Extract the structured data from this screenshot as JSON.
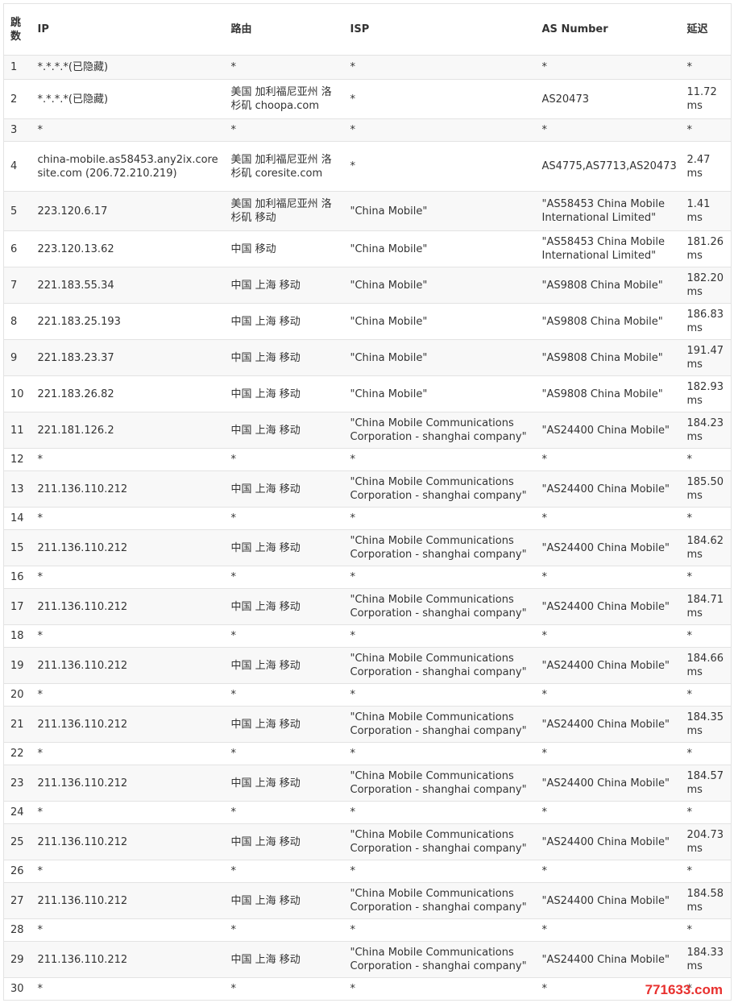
{
  "headers": [
    "跳数",
    "IP",
    "路由",
    "ISP",
    "AS Number",
    "延迟"
  ],
  "rows": [
    {
      "hop": "1",
      "ip": "*.*.*.*(已隐藏)",
      "route": "*",
      "isp": "*",
      "asn": "*",
      "delay": "*",
      "h": 30
    },
    {
      "hop": "2",
      "ip": "*.*.*.*(已隐藏)",
      "route": "美国 加利福尼亚州 洛杉矶 choopa.com",
      "isp": "*",
      "asn": "AS20473",
      "delay": "11.72 ms",
      "h": 49
    },
    {
      "hop": "3",
      "ip": "*",
      "route": "*",
      "isp": "*",
      "asn": "*",
      "delay": "*",
      "h": 28
    },
    {
      "hop": "4",
      "ip": "china-mobile.as58453.any2ix.coresite.com (206.72.210.219)",
      "route": "美国 加利福尼亚州 洛杉矶 coresite.com",
      "isp": "*",
      "asn": "AS4775,AS7713,AS20473",
      "delay": "2.47 ms",
      "h": 62
    },
    {
      "hop": "5",
      "ip": "223.120.6.17",
      "route": "美国 加利福尼亚州 洛杉矶 移动",
      "isp": "\"China Mobile\"",
      "asn": "\"AS58453 China Mobile International Limited\"",
      "delay": "1.41 ms",
      "h": 49
    },
    {
      "hop": "6",
      "ip": "223.120.13.62",
      "route": "中国 移动",
      "isp": "\"China Mobile\"",
      "asn": "\"AS58453 China Mobile International Limited\"",
      "delay": "181.26 ms",
      "h": 45
    },
    {
      "hop": "7",
      "ip": "221.183.55.34",
      "route": "中国 上海 移动",
      "isp": "\"China Mobile\"",
      "asn": "\"AS9808 China Mobile\"",
      "delay": "182.20 ms",
      "h": 45
    },
    {
      "hop": "8",
      "ip": "221.183.25.193",
      "route": "中国 上海 移动",
      "isp": "\"China Mobile\"",
      "asn": "\"AS9808 China Mobile\"",
      "delay": "186.83 ms",
      "h": 45
    },
    {
      "hop": "9",
      "ip": "221.183.23.37",
      "route": "中国 上海 移动",
      "isp": "\"China Mobile\"",
      "asn": "\"AS9808 China Mobile\"",
      "delay": "191.47 ms",
      "h": 45
    },
    {
      "hop": "10",
      "ip": "221.183.26.82",
      "route": "中国 上海 移动",
      "isp": "\"China Mobile\"",
      "asn": "\"AS9808 China Mobile\"",
      "delay": "182.93 ms",
      "h": 45
    },
    {
      "hop": "11",
      "ip": "221.181.126.2",
      "route": "中国 上海 移动",
      "isp": "\"China Mobile Communications Corporation - shanghai company\"",
      "asn": "\"AS24400 China Mobile\"",
      "delay": "184.23 ms",
      "h": 45
    },
    {
      "hop": "12",
      "ip": "*",
      "route": "*",
      "isp": "*",
      "asn": "*",
      "delay": "*",
      "h": 28
    },
    {
      "hop": "13",
      "ip": "211.136.110.212",
      "route": "中国 上海 移动",
      "isp": "\"China Mobile Communications Corporation - shanghai company\"",
      "asn": "\"AS24400 China Mobile\"",
      "delay": "185.50 ms",
      "h": 45
    },
    {
      "hop": "14",
      "ip": "*",
      "route": "*",
      "isp": "*",
      "asn": "*",
      "delay": "*",
      "h": 28
    },
    {
      "hop": "15",
      "ip": "211.136.110.212",
      "route": "中国 上海 移动",
      "isp": "\"China Mobile Communications Corporation - shanghai company\"",
      "asn": "\"AS24400 China Mobile\"",
      "delay": "184.62 ms",
      "h": 45
    },
    {
      "hop": "16",
      "ip": "*",
      "route": "*",
      "isp": "*",
      "asn": "*",
      "delay": "*",
      "h": 28
    },
    {
      "hop": "17",
      "ip": "211.136.110.212",
      "route": "中国 上海 移动",
      "isp": "\"China Mobile Communications Corporation - shanghai company\"",
      "asn": "\"AS24400 China Mobile\"",
      "delay": "184.71 ms",
      "h": 45
    },
    {
      "hop": "18",
      "ip": "*",
      "route": "*",
      "isp": "*",
      "asn": "*",
      "delay": "*",
      "h": 28
    },
    {
      "hop": "19",
      "ip": "211.136.110.212",
      "route": "中国 上海 移动",
      "isp": "\"China Mobile Communications Corporation - shanghai company\"",
      "asn": "\"AS24400 China Mobile\"",
      "delay": "184.66 ms",
      "h": 45
    },
    {
      "hop": "20",
      "ip": "*",
      "route": "*",
      "isp": "*",
      "asn": "*",
      "delay": "*",
      "h": 28
    },
    {
      "hop": "21",
      "ip": "211.136.110.212",
      "route": "中国 上海 移动",
      "isp": "\"China Mobile Communications Corporation - shanghai company\"",
      "asn": "\"AS24400 China Mobile\"",
      "delay": "184.35 ms",
      "h": 45
    },
    {
      "hop": "22",
      "ip": "*",
      "route": "*",
      "isp": "*",
      "asn": "*",
      "delay": "*",
      "h": 28
    },
    {
      "hop": "23",
      "ip": "211.136.110.212",
      "route": "中国 上海 移动",
      "isp": "\"China Mobile Communications Corporation - shanghai company\"",
      "asn": "\"AS24400 China Mobile\"",
      "delay": "184.57 ms",
      "h": 45
    },
    {
      "hop": "24",
      "ip": "*",
      "route": "*",
      "isp": "*",
      "asn": "*",
      "delay": "*",
      "h": 28
    },
    {
      "hop": "25",
      "ip": "211.136.110.212",
      "route": "中国 上海 移动",
      "isp": "\"China Mobile Communications Corporation - shanghai company\"",
      "asn": "\"AS24400 China Mobile\"",
      "delay": "204.73 ms",
      "h": 45
    },
    {
      "hop": "26",
      "ip": "*",
      "route": "*",
      "isp": "*",
      "asn": "*",
      "delay": "*",
      "h": 28
    },
    {
      "hop": "27",
      "ip": "211.136.110.212",
      "route": "中国 上海 移动",
      "isp": "\"China Mobile Communications Corporation - shanghai company\"",
      "asn": "\"AS24400 China Mobile\"",
      "delay": "184.58 ms",
      "h": 45
    },
    {
      "hop": "28",
      "ip": "*",
      "route": "*",
      "isp": "*",
      "asn": "*",
      "delay": "*",
      "h": 28
    },
    {
      "hop": "29",
      "ip": "211.136.110.212",
      "route": "中国 上海 移动",
      "isp": "\"China Mobile Communications Corporation - shanghai company\"",
      "asn": "\"AS24400 China Mobile\"",
      "delay": "184.33 ms",
      "h": 45
    },
    {
      "hop": "30",
      "ip": "*",
      "route": "*",
      "isp": "*",
      "asn": "*",
      "delay": "*",
      "h": 28
    }
  ],
  "watermark": "771633.com"
}
